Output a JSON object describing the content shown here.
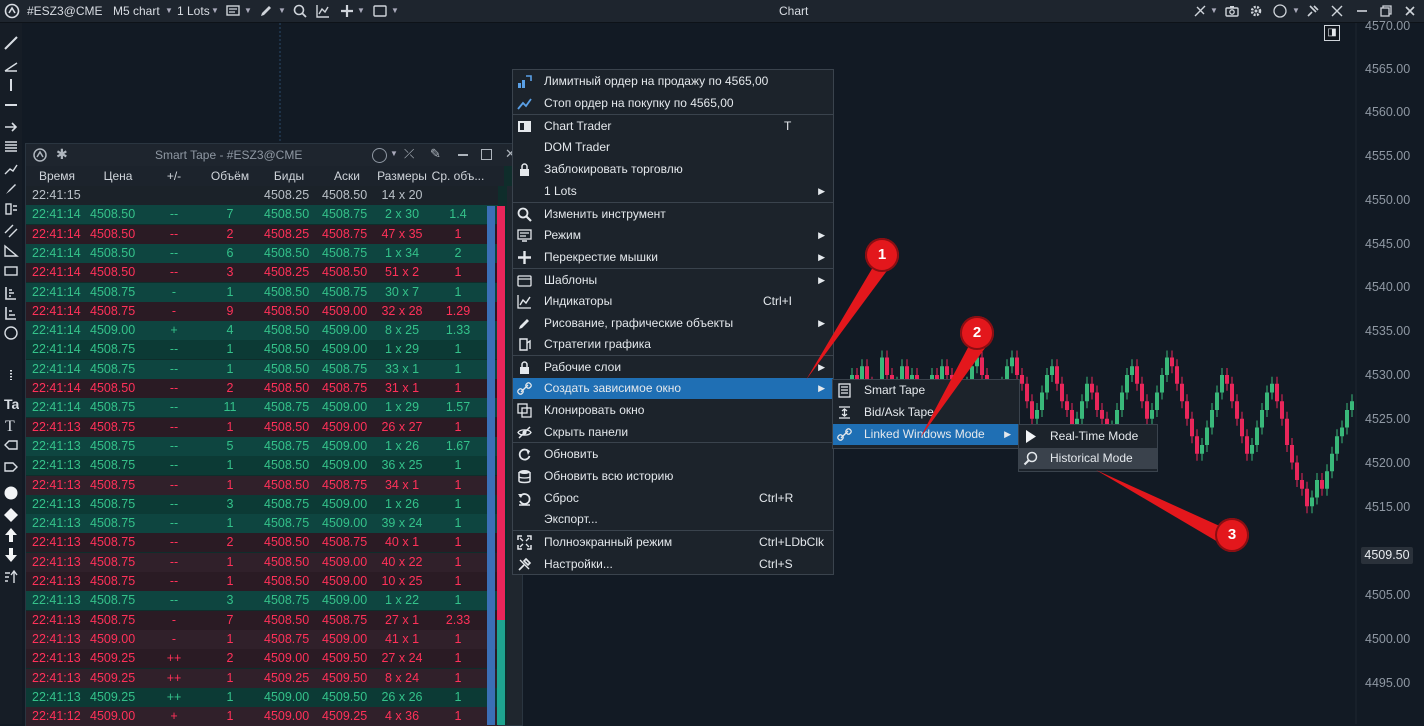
{
  "toolbar": {
    "symbol": "#ESZ3@CME",
    "chart_type": "M5 chart",
    "lots": "1 Lots",
    "window_title": "Chart",
    "icons": [
      "logo-icon",
      "bar-style-icon",
      "pencil-icon",
      "zoom-icon",
      "indicator-icon",
      "crosshair-icon",
      "layout-icon",
      "link-icon",
      "camera-icon",
      "circle-icon",
      "pin-icon",
      "minimize-icon",
      "maximize-icon",
      "close-icon"
    ]
  },
  "left_tools": [
    "line-tool-icon",
    "ray-tool-icon",
    "vertical-line-icon",
    "horizontal-line-icon",
    "arrow-icon",
    "fibonacci-icon",
    "trend-icon",
    "brush-icon",
    "channel-icon",
    "parallel-icon",
    "triangle-icon",
    "rectangle-icon",
    "bars-icon",
    "levels-icon",
    "circle-tool-icon",
    "dots-icon",
    "text-icon",
    "text-t-icon",
    "label-icon",
    "tag-icon",
    "dot-icon",
    "diamond-icon",
    "arrow-up-icon",
    "arrow-down-icon",
    "sort-icon"
  ],
  "chart": {
    "expand_label": "◨",
    "price_labels": [
      "4570.00",
      "4565.00",
      "4560.00",
      "4555.00",
      "4550.00",
      "4545.00",
      "4540.00",
      "4535.00",
      "4530.00",
      "4525.00",
      "4520.00",
      "4515.00",
      "4505.00",
      "4500.00",
      "4495.00"
    ],
    "current_price": "4509.50",
    "colors": {
      "up": "#39b87a",
      "down": "#e8265a",
      "background": "#121a24"
    }
  },
  "smart_tape": {
    "title": "Smart Tape - #ESZ3@CME",
    "columns": [
      "Время",
      "Цена",
      "+/-",
      "Объём",
      "Биды",
      "Аски",
      "Размеры",
      "Ср. объ..."
    ],
    "rows": [
      {
        "t": "22:41:15",
        "p": "",
        "d": "",
        "v": "",
        "b": "4508.25",
        "a": "4508.50",
        "s": "14 x 20",
        "avg": "",
        "k": "f"
      },
      {
        "t": "22:41:14",
        "p": "4508.50",
        "d": "--",
        "v": "7",
        "b": "4508.50",
        "a": "4508.75",
        "s": "2 x 30",
        "avg": "1.4",
        "k": "g"
      },
      {
        "t": "22:41:14",
        "p": "4508.50",
        "d": "--",
        "v": "2",
        "b": "4508.25",
        "a": "4508.75",
        "s": "47 x 35",
        "avg": "1",
        "k": "r"
      },
      {
        "t": "22:41:14",
        "p": "4508.50",
        "d": "--",
        "v": "6",
        "b": "4508.50",
        "a": "4508.75",
        "s": "1 x 34",
        "avg": "2",
        "k": "g"
      },
      {
        "t": "22:41:14",
        "p": "4508.50",
        "d": "--",
        "v": "3",
        "b": "4508.25",
        "a": "4508.50",
        "s": "51 x 2",
        "avg": "1",
        "k": "r"
      },
      {
        "t": "22:41:14",
        "p": "4508.75",
        "d": "-",
        "v": "1",
        "b": "4508.50",
        "a": "4508.75",
        "s": "30 x 7",
        "avg": "1",
        "k": "g"
      },
      {
        "t": "22:41:14",
        "p": "4508.75",
        "d": "-",
        "v": "9",
        "b": "4508.50",
        "a": "4509.00",
        "s": "32 x 28",
        "avg": "1.29",
        "k": "r"
      },
      {
        "t": "22:41:14",
        "p": "4509.00",
        "d": "+",
        "v": "4",
        "b": "4508.50",
        "a": "4509.00",
        "s": "8 x 25",
        "avg": "1.33",
        "k": "g"
      },
      {
        "t": "22:41:14",
        "p": "4508.75",
        "d": "--",
        "v": "1",
        "b": "4508.50",
        "a": "4509.00",
        "s": "1 x 29",
        "avg": "1",
        "k": "g"
      },
      {
        "t": "22:41:14",
        "p": "4508.75",
        "d": "--",
        "v": "1",
        "b": "4508.50",
        "a": "4508.75",
        "s": "33 x 1",
        "avg": "1",
        "k": "g"
      },
      {
        "t": "22:41:14",
        "p": "4508.50",
        "d": "--",
        "v": "2",
        "b": "4508.50",
        "a": "4508.75",
        "s": "31 x 1",
        "avg": "1",
        "k": "r"
      },
      {
        "t": "22:41:14",
        "p": "4508.75",
        "d": "--",
        "v": "11",
        "b": "4508.75",
        "a": "4509.00",
        "s": "1 x 29",
        "avg": "1.57",
        "k": "g"
      },
      {
        "t": "22:41:13",
        "p": "4508.75",
        "d": "--",
        "v": "1",
        "b": "4508.50",
        "a": "4509.00",
        "s": "26 x 27",
        "avg": "1",
        "k": "r"
      },
      {
        "t": "22:41:13",
        "p": "4508.75",
        "d": "--",
        "v": "5",
        "b": "4508.75",
        "a": "4509.00",
        "s": "1 x 26",
        "avg": "1.67",
        "k": "g"
      },
      {
        "t": "22:41:13",
        "p": "4508.75",
        "d": "--",
        "v": "1",
        "b": "4508.50",
        "a": "4509.00",
        "s": "36 x 25",
        "avg": "1",
        "k": "g"
      },
      {
        "t": "22:41:13",
        "p": "4508.75",
        "d": "--",
        "v": "1",
        "b": "4508.50",
        "a": "4508.75",
        "s": "34 x 1",
        "avg": "1",
        "k": "r"
      },
      {
        "t": "22:41:13",
        "p": "4508.75",
        "d": "--",
        "v": "3",
        "b": "4508.75",
        "a": "4509.00",
        "s": "1 x 26",
        "avg": "1",
        "k": "g"
      },
      {
        "t": "22:41:13",
        "p": "4508.75",
        "d": "--",
        "v": "1",
        "b": "4508.75",
        "a": "4509.00",
        "s": "39 x 24",
        "avg": "1",
        "k": "g"
      },
      {
        "t": "22:41:13",
        "p": "4508.75",
        "d": "--",
        "v": "2",
        "b": "4508.50",
        "a": "4508.75",
        "s": "40 x 1",
        "avg": "1",
        "k": "r"
      },
      {
        "t": "22:41:13",
        "p": "4508.75",
        "d": "--",
        "v": "1",
        "b": "4508.50",
        "a": "4509.00",
        "s": "40 x 22",
        "avg": "1",
        "k": "r"
      },
      {
        "t": "22:41:13",
        "p": "4508.75",
        "d": "--",
        "v": "1",
        "b": "4508.50",
        "a": "4509.00",
        "s": "10 x 25",
        "avg": "1",
        "k": "r"
      },
      {
        "t": "22:41:13",
        "p": "4508.75",
        "d": "--",
        "v": "3",
        "b": "4508.75",
        "a": "4509.00",
        "s": "1 x 22",
        "avg": "1",
        "k": "g"
      },
      {
        "t": "22:41:13",
        "p": "4508.75",
        "d": "-",
        "v": "7",
        "b": "4508.50",
        "a": "4508.75",
        "s": "27 x 1",
        "avg": "2.33",
        "k": "r"
      },
      {
        "t": "22:41:13",
        "p": "4509.00",
        "d": "-",
        "v": "1",
        "b": "4508.75",
        "a": "4509.00",
        "s": "41 x 1",
        "avg": "1",
        "k": "r"
      },
      {
        "t": "22:41:13",
        "p": "4509.25",
        "d": "++",
        "v": "2",
        "b": "4509.00",
        "a": "4509.50",
        "s": "27 x 24",
        "avg": "1",
        "k": "r"
      },
      {
        "t": "22:41:13",
        "p": "4509.25",
        "d": "++",
        "v": "1",
        "b": "4509.25",
        "a": "4509.50",
        "s": "8 x 24",
        "avg": "1",
        "k": "r"
      },
      {
        "t": "22:41:13",
        "p": "4509.25",
        "d": "++",
        "v": "1",
        "b": "4509.00",
        "a": "4509.50",
        "s": "26 x 26",
        "avg": "1",
        "k": "g"
      },
      {
        "t": "22:41:12",
        "p": "4509.00",
        "d": "+",
        "v": "1",
        "b": "4509.00",
        "a": "4509.25",
        "s": "4 x 36",
        "avg": "1",
        "k": "r"
      }
    ]
  },
  "menu": {
    "items": [
      {
        "label": "Лимитный ордер на продажу по 4565,00",
        "shortcut": "",
        "arrow": false,
        "icon": "limit-order-icon"
      },
      {
        "label": "Стоп ордер на покупку по 4565,00",
        "shortcut": "",
        "arrow": false,
        "icon": "stop-order-icon"
      },
      {
        "label": "Chart Trader",
        "shortcut": "T",
        "arrow": false,
        "icon": "chart-trader-icon"
      },
      {
        "label": "DOM Trader",
        "shortcut": "",
        "arrow": false,
        "icon": ""
      },
      {
        "label": "Заблокировать торговлю",
        "shortcut": "",
        "arrow": false,
        "icon": "lock-icon"
      },
      {
        "label": "1 Lots",
        "shortcut": "",
        "arrow": true,
        "icon": ""
      },
      {
        "label": "Изменить инструмент",
        "shortcut": "",
        "arrow": false,
        "icon": "search-icon"
      },
      {
        "label": "Режим",
        "shortcut": "",
        "arrow": true,
        "icon": "mode-icon"
      },
      {
        "label": "Перекрестие мышки",
        "shortcut": "",
        "arrow": true,
        "icon": "crosshair-icon"
      },
      {
        "label": "Шаблоны",
        "shortcut": "",
        "arrow": true,
        "icon": "templates-icon"
      },
      {
        "label": "Индикаторы",
        "shortcut": "Ctrl+I",
        "arrow": false,
        "icon": "indicators-icon"
      },
      {
        "label": "Рисование, графические объекты",
        "shortcut": "",
        "arrow": true,
        "icon": "pencil-icon"
      },
      {
        "label": "Стратегии графика",
        "shortcut": "",
        "arrow": false,
        "icon": "strategy-icon"
      },
      {
        "label": "Рабочие слои",
        "shortcut": "",
        "arrow": true,
        "icon": "lock-icon"
      },
      {
        "label": "Создать зависимое окно",
        "shortcut": "",
        "arrow": true,
        "icon": "link-icon"
      },
      {
        "label": "Клонировать окно",
        "shortcut": "",
        "arrow": false,
        "icon": "clone-icon"
      },
      {
        "label": "Скрыть панели",
        "shortcut": "",
        "arrow": false,
        "icon": "eye-off-icon"
      },
      {
        "label": "Обновить",
        "shortcut": "",
        "arrow": false,
        "icon": "refresh-icon"
      },
      {
        "label": "Обновить всю историю",
        "shortcut": "",
        "arrow": false,
        "icon": "database-icon"
      },
      {
        "label": "Сброс",
        "shortcut": "Ctrl+R",
        "arrow": false,
        "icon": "reset-icon"
      },
      {
        "label": "Экспорт...",
        "shortcut": "",
        "arrow": false,
        "icon": ""
      },
      {
        "label": "Полноэкранный режим",
        "shortcut": "Ctrl+LDbClk",
        "arrow": false,
        "icon": "fullscreen-icon"
      },
      {
        "label": "Настройки...",
        "shortcut": "Ctrl+S",
        "arrow": false,
        "icon": "settings-icon"
      }
    ]
  },
  "submenu_linked": {
    "items": [
      {
        "label": "Smart Tape",
        "icon": "smart-tape-icon"
      },
      {
        "label": "Bid/Ask Tape",
        "icon": "bidask-tape-icon"
      },
      {
        "label": "Linked Windows Mode",
        "icon": "link-icon"
      }
    ]
  },
  "submenu_mode": {
    "items": [
      {
        "label": "Real-Time Mode",
        "icon": "play-icon"
      },
      {
        "label": "Historical Mode",
        "icon": "history-search-icon"
      }
    ]
  },
  "callouts": [
    "1",
    "2",
    "3"
  ]
}
